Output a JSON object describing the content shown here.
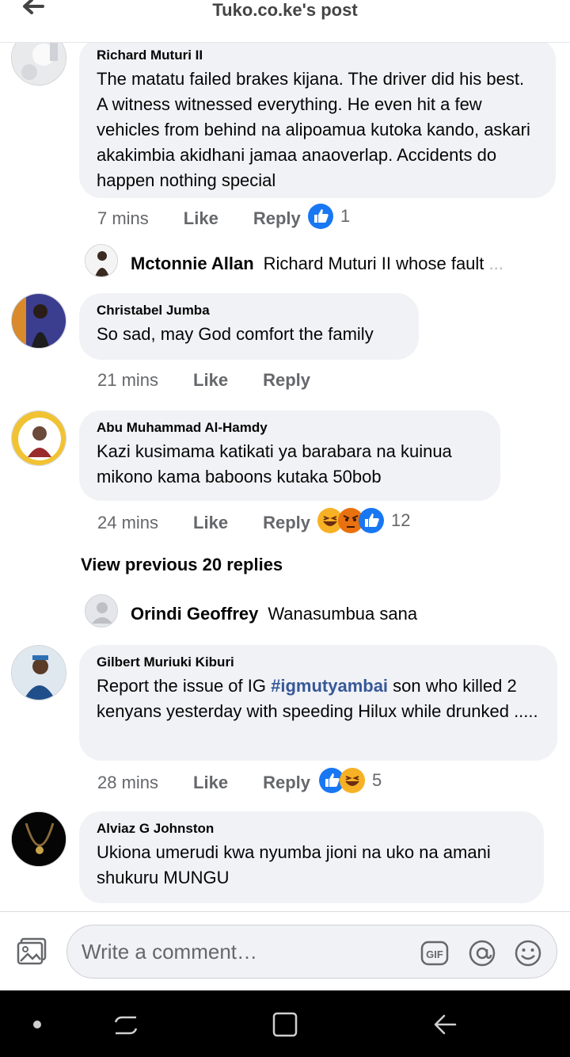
{
  "header": {
    "title": "Tuko.co.ke's post"
  },
  "comments": [
    {
      "author": "Richard Muturi II",
      "text": "The matatu failed brakes kijana. The driver did his best. A witness  witnessed everything. He even hit a few vehicles from behind na alipoamua kutoka kando, askari akakimbia akidhani jamaa anaoverlap. Accidents do happen nothing special",
      "time": "7 mins",
      "like": "Like",
      "reply": "Reply",
      "reaction_count": "1",
      "reactions": [
        "like"
      ]
    },
    {
      "author": "Christabel Jumba",
      "text": "So sad, may God comfort the family",
      "time": "21 mins",
      "like": "Like",
      "reply": "Reply"
    },
    {
      "author": "Abu Muhammad Al-Hamdy",
      "text": "Kazi kusimama katikati ya barabara na kuinua mikono kama baboons kutaka 50bob",
      "time": "24 mins",
      "like": "Like",
      "reply": "Reply",
      "reaction_count": "12",
      "reactions": [
        "haha",
        "angry",
        "like"
      ]
    },
    {
      "author": "Gilbert Muriuki Kiburi",
      "text_before": "Report the issue of IG ",
      "hashtag": "#igmutyambai",
      "text_after": "  son who killed 2 kenyans yesterday     with speeding Hilux  while drunked .....",
      "time": "28 mins",
      "like": "Like",
      "reply": "Reply",
      "reaction_count": "5",
      "reactions": [
        "like",
        "haha"
      ]
    },
    {
      "author": "Alviaz G Johnston",
      "text": "Ukiona umerudi kwa nyumba jioni na uko na amani shukuru MUNGU"
    }
  ],
  "replies": [
    {
      "author": "Mctonnie Allan",
      "text": "Richard Muturi II whose fault",
      "ellipsis": "..."
    },
    {
      "author": "Orindi Geoffrey",
      "text": "Wanasumbua sana"
    }
  ],
  "view_previous": "View previous 20 replies",
  "composer": {
    "placeholder": "Write a comment…"
  },
  "icons": {
    "back": "arrow-left-icon",
    "photo": "photo-icon",
    "gif": "gif-icon",
    "mention": "at-icon",
    "emoji": "smiley-icon",
    "nav": [
      "dot-icon",
      "recent-apps-icon",
      "home-icon",
      "back-nav-icon"
    ]
  },
  "colors": {
    "like_blue": "#1877f2",
    "bubble": "#f0f2f5",
    "hashtag": "#385898",
    "secondary_text": "#65676b"
  }
}
